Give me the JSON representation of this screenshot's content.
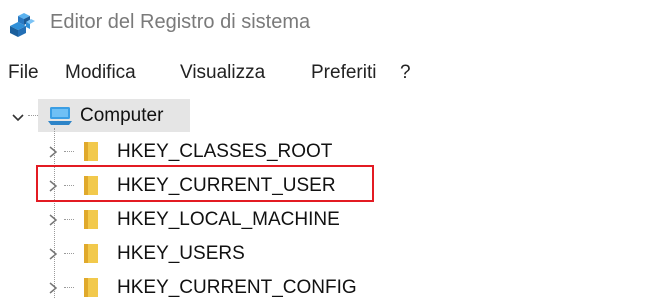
{
  "window": {
    "title": "Editor del Registro di sistema",
    "icon": "registry-editor-icon"
  },
  "menu": [
    {
      "label": "File"
    },
    {
      "label": "Modifica"
    },
    {
      "label": "Visualizza"
    },
    {
      "label": "Preferiti"
    },
    {
      "label": "?"
    }
  ],
  "tree": {
    "root": {
      "label": "Computer",
      "icon": "computer-icon",
      "expanded": true
    },
    "keys": [
      {
        "label": "HKEY_CLASSES_ROOT",
        "icon": "folder-icon"
      },
      {
        "label": "HKEY_CURRENT_USER",
        "icon": "folder-icon",
        "highlighted": true
      },
      {
        "label": "HKEY_LOCAL_MACHINE",
        "icon": "folder-icon"
      },
      {
        "label": "HKEY_USERS",
        "icon": "folder-icon"
      },
      {
        "label": "HKEY_CURRENT_CONFIG",
        "icon": "folder-icon"
      }
    ]
  },
  "colors": {
    "highlight_border": "#e31b23",
    "folder": "#f2c94c",
    "title_text": "#7a7a7a"
  }
}
